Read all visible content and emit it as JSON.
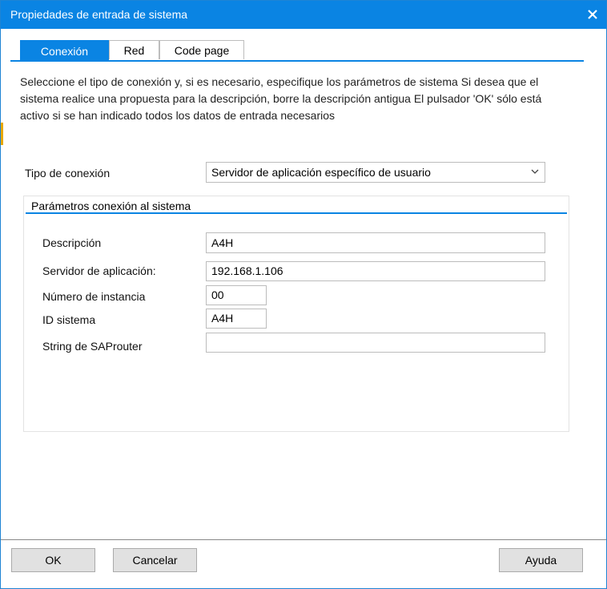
{
  "window": {
    "title": "Propiedades de entrada de sistema"
  },
  "tabs": [
    {
      "label": "Conexión",
      "active": true
    },
    {
      "label": "Red",
      "active": false
    },
    {
      "label": "Code page",
      "active": false
    }
  ],
  "instructions": "Seleccione el tipo de conexión y, si es necesario, especifique los parámetros de sistema Si desea que el sistema realice una propuesta para la descripción, borre la descripción antigua El pulsador 'OK' sólo está activo si se han indicado todos los datos de entrada necesarios",
  "connection_type": {
    "label": "Tipo de conexión",
    "value": "Servidor de aplicación específico de usuario"
  },
  "group": {
    "title": "Parámetros conexión al sistema",
    "fields": {
      "description": {
        "label": "Descripción",
        "value": "A4H"
      },
      "app_server": {
        "label": "Servidor de aplicación:",
        "value": "192.168.1.106"
      },
      "instance": {
        "label": "Número de instancia",
        "value": "00"
      },
      "system_id": {
        "label": "ID sistema",
        "value": "A4H"
      },
      "saprouter": {
        "label": "String de SAProuter",
        "value": ""
      }
    }
  },
  "buttons": {
    "ok": "OK",
    "cancel": "Cancelar",
    "help": "Ayuda"
  },
  "colors": {
    "accent": "#0a84e3"
  }
}
